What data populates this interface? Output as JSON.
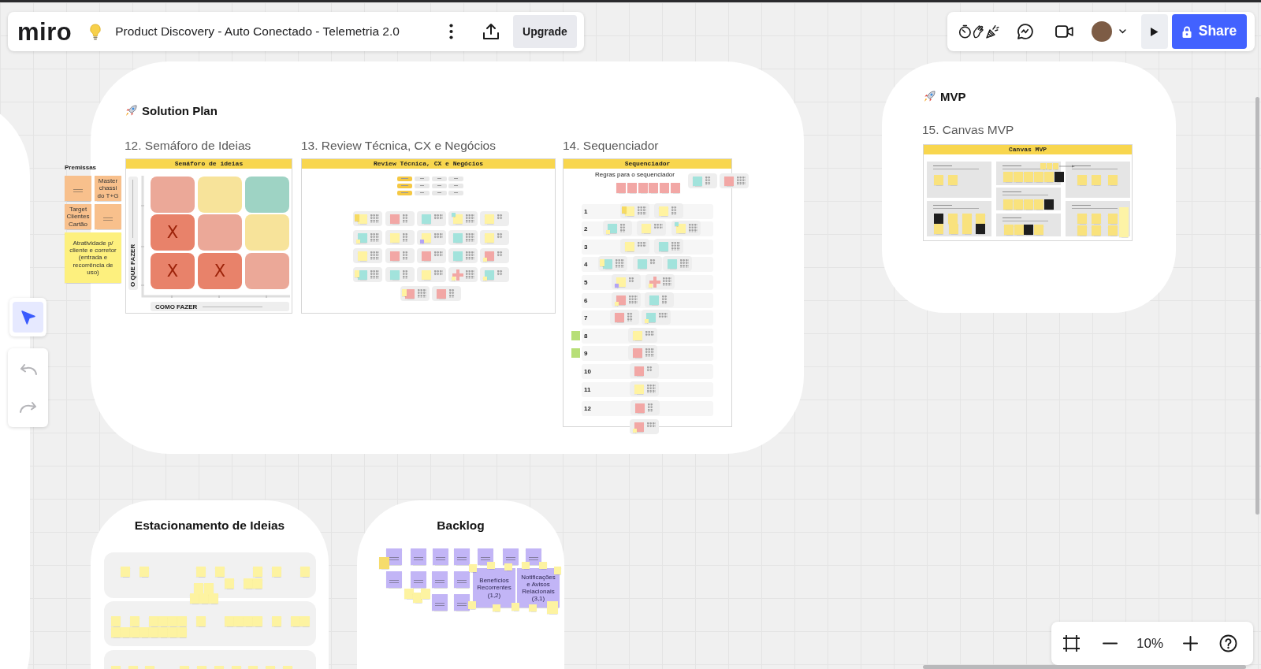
{
  "top_bar": {
    "logo": "miro",
    "board_title": "Product Discovery - Auto Conectado - Telemetria 2.0",
    "upgrade_button": "Upgrade"
  },
  "collab_bar": {
    "share_button": "Share"
  },
  "tools": [
    {
      "kind": "select",
      "selected": true
    }
  ],
  "history": [
    {
      "kind": "undo",
      "disabled": true
    },
    {
      "kind": "redo",
      "disabled": true
    }
  ],
  "solution_plan": {
    "title": "Solution Plan",
    "premises": {
      "title": "Premissas",
      "notes": [
        {
          "color": "#f8c08c"
        },
        {
          "color": "#f8c08c",
          "text": "Master chassi do T+G"
        },
        {
          "color": "#f8c08c",
          "text": "Target Clientes Cartão"
        },
        {
          "color": "#f8c08c"
        },
        {
          "color": "#fdf07e",
          "text": "Atratividade p/ cliente e corretor (entrada e recorrência de uso)"
        }
      ]
    },
    "semaforo": {
      "heading": "12. Semáforo de Ideias",
      "board_title": "Semáforo de ideias",
      "y_axis": "O QUE FAZER",
      "x_axis": "COMO FAZER",
      "cells": [
        {
          "color": "#eba898"
        },
        {
          "color": "#f7e39a"
        },
        {
          "color": "#9ed3c4"
        },
        {
          "color": "#e8826a",
          "text": "X"
        },
        {
          "color": "#eba898"
        },
        {
          "color": "#f7e39a"
        },
        {
          "color": "#e8826a",
          "text": "X"
        },
        {
          "color": "#e8826a",
          "text": "X"
        },
        {
          "color": "#eba898"
        }
      ]
    },
    "review": {
      "heading": "13. Review Técnica, CX e Negócios",
      "board_title": "Review Técnica, CX e Negócios"
    },
    "sequencer": {
      "heading": "14. Sequenciador",
      "board_title": "Sequenciador",
      "rules_title": "Regras para o sequenciador",
      "rows": [
        {
          "label": "1",
          "flagged": false
        },
        {
          "label": "2",
          "flagged": false
        },
        {
          "label": "3",
          "flagged": false
        },
        {
          "label": "4",
          "flagged": false
        },
        {
          "label": "5",
          "flagged": false
        },
        {
          "label": "6",
          "flagged": false
        },
        {
          "label": "7",
          "flagged": false
        },
        {
          "label": "8",
          "flagged": true
        },
        {
          "label": "9",
          "flagged": true
        },
        {
          "label": "10",
          "flagged": false
        },
        {
          "label": "11",
          "flagged": false
        },
        {
          "label": "12",
          "flagged": false
        }
      ]
    }
  },
  "mvp": {
    "title": "MVP",
    "heading": "15. Canvas MVP",
    "board_title": "Canvas MVP"
  },
  "parking_lot": {
    "title": "Estacionamento de Ideias"
  },
  "backlog": {
    "title": "Backlog",
    "notes": [
      {
        "text": "Benefícios Recorrentes (1,2)"
      },
      {
        "text": "Notificações e Avisos Relacionais (3,1)"
      }
    ]
  },
  "zoom_control": {
    "value": "10%"
  }
}
